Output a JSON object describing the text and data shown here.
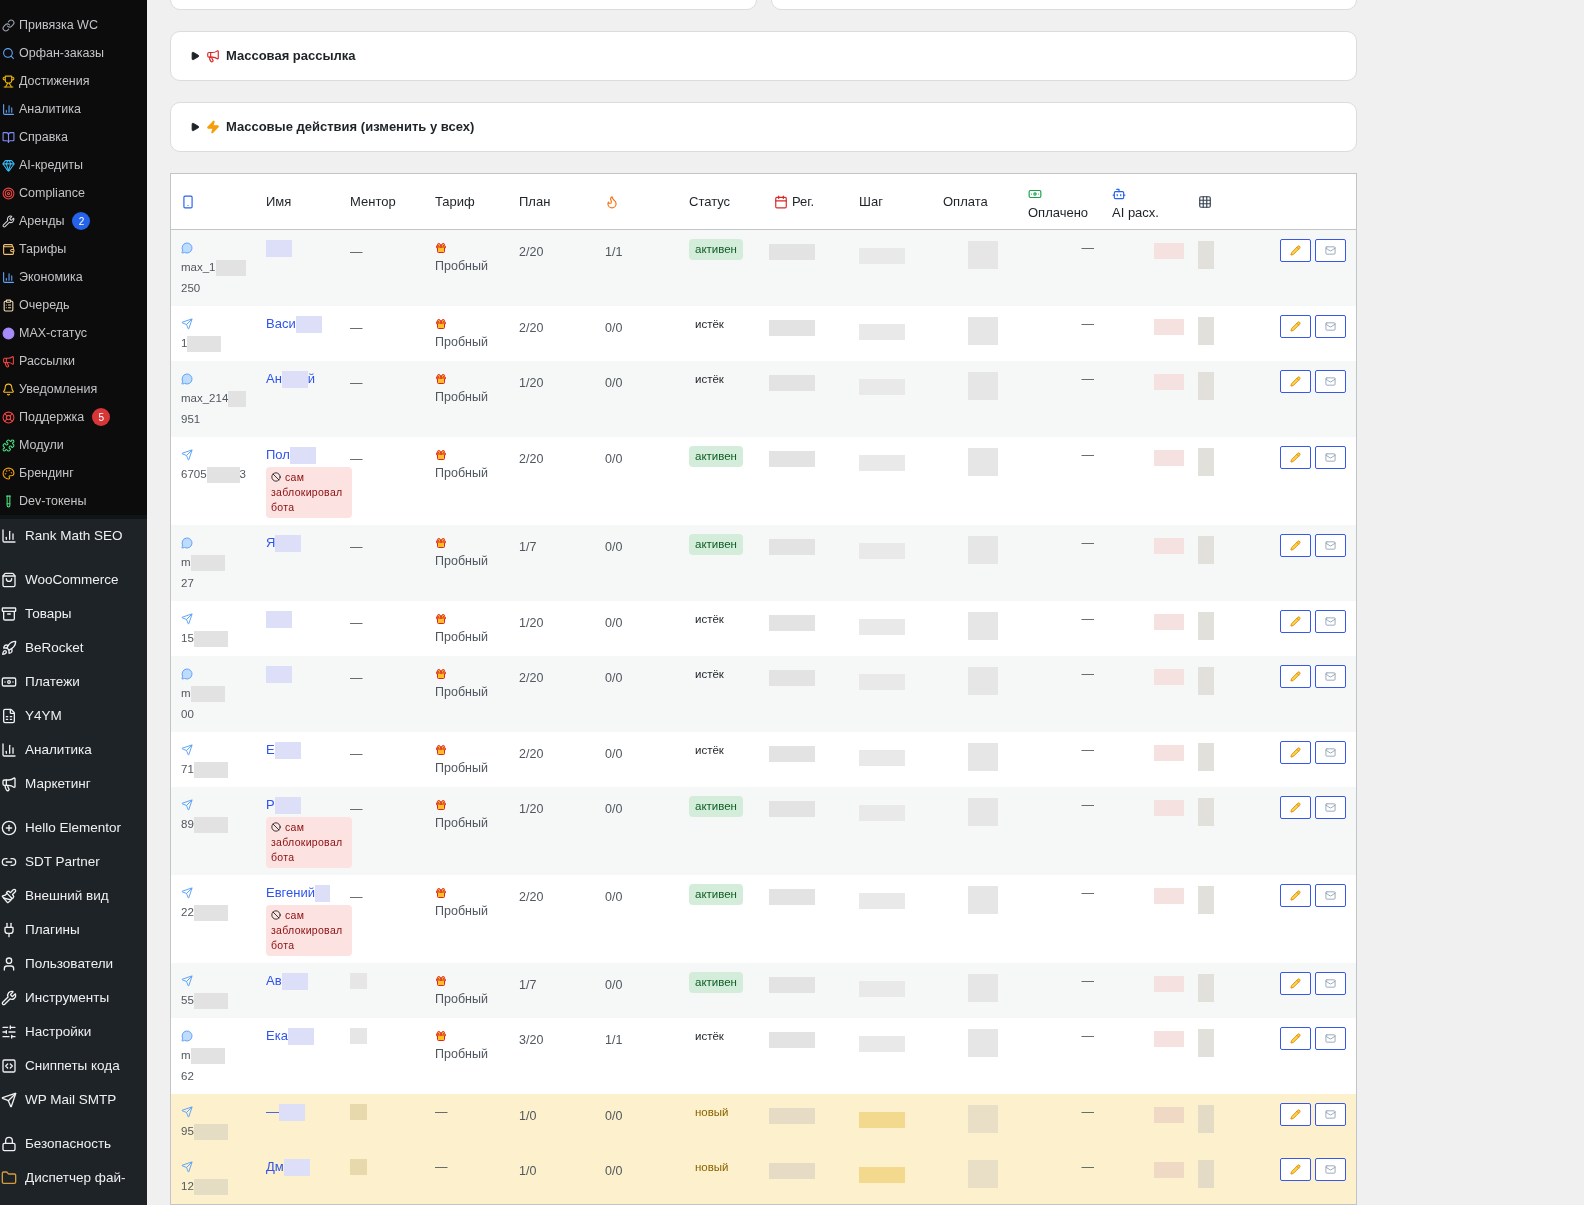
{
  "sidebar": {
    "submenu": [
      {
        "label": "Привязка WC"
      },
      {
        "label": "Орфан-заказы"
      },
      {
        "label": "Достижения"
      },
      {
        "label": "Аналитика"
      },
      {
        "label": "Справка"
      },
      {
        "label": "AI-кредиты"
      },
      {
        "label": "Compliance"
      },
      {
        "label": "Аренды",
        "badge": {
          "count": "2",
          "color": "#2563eb"
        }
      },
      {
        "label": "Тарифы"
      },
      {
        "label": "Экономика"
      },
      {
        "label": "Очередь"
      },
      {
        "label": "MAX-статус"
      },
      {
        "label": "Рассылки"
      },
      {
        "label": "Уведомления"
      },
      {
        "label": "Поддержка",
        "badge": {
          "count": "5",
          "color": "#d63638"
        }
      },
      {
        "label": "Модули"
      },
      {
        "label": "Брендинг"
      },
      {
        "label": "Dev-токены"
      }
    ],
    "menu_groups": [
      [
        "Rank Math SEO"
      ],
      [
        "WooCommerce",
        "Товары",
        "BeRocket",
        "Платежи",
        "Y4YM",
        "Аналитика",
        "Маркетинг"
      ],
      [
        "Hello Elementor",
        "SDT Partner",
        "Внешний вид",
        "Плагины",
        "Пользователи",
        "Инструменты",
        "Настройки",
        "Сниппеты кода",
        "WP Mail SMTP"
      ],
      [
        "Безопасность",
        "Диспетчер фай-"
      ]
    ]
  },
  "panels": [
    {
      "title": "Массовая рассылка",
      "expanded": false
    },
    {
      "title": "Массовые действия (изменить у всех)",
      "expanded": false
    }
  ],
  "table": {
    "columns": [
      {
        "kind": "icon"
      },
      {
        "kind": "text",
        "label": "Имя"
      },
      {
        "kind": "text",
        "label": "Ментор"
      },
      {
        "kind": "text",
        "label": "Тариф"
      },
      {
        "kind": "text",
        "label": "План"
      },
      {
        "kind": "icon"
      },
      {
        "kind": "text",
        "label": "Статус"
      },
      {
        "kind": "icon_inline",
        "label": "Рег."
      },
      {
        "kind": "text",
        "label": "Шаг"
      },
      {
        "kind": "text",
        "label": "Оплата"
      },
      {
        "kind": "icon_stacked",
        "label": "Оплачено"
      },
      {
        "kind": "icon_stacked",
        "label": "AI расх."
      },
      {
        "kind": "icon"
      }
    ],
    "rows": [
      {
        "channel": {
          "kind": "max",
          "id_lines": [
            "max_1",
            "250"
          ]
        },
        "mentor": "—",
        "tariff": {
          "kind": "trial",
          "label": "Пробный"
        },
        "plan": "2/20",
        "streak": "1/1",
        "status": {
          "kind": "active",
          "label": "активен"
        },
        "paid": "—"
      },
      {
        "channel": {
          "kind": "telegram",
          "id_lines": [
            "1"
          ]
        },
        "name": "Васи",
        "mentor": "—",
        "tariff": {
          "kind": "trial",
          "label": "Пробный"
        },
        "plan": "2/20",
        "streak": "0/0",
        "status": {
          "kind": "expired",
          "label": "истёк"
        },
        "paid": "—"
      },
      {
        "channel": {
          "kind": "max",
          "id_lines": [
            "max_214",
            "951"
          ]
        },
        "name": "Ан",
        "name_end": "й",
        "mentor": "—",
        "tariff": {
          "kind": "trial",
          "label": "Пробный"
        },
        "plan": "1/20",
        "streak": "0/0",
        "status": {
          "kind": "expired",
          "label": "истёк"
        },
        "paid": "—"
      },
      {
        "channel": {
          "kind": "telegram",
          "id_lines": [
            "6705"
          ],
          "id_end": "3"
        },
        "name": "Пол",
        "blocked": "сам заблокировал бота",
        "mentor": "—",
        "tariff": {
          "kind": "trial",
          "label": "Пробный"
        },
        "plan": "2/20",
        "streak": "0/0",
        "status": {
          "kind": "active",
          "label": "активен"
        },
        "paid": "—"
      },
      {
        "channel": {
          "kind": "max",
          "id_lines": [
            "m",
            "27"
          ]
        },
        "name": "Я",
        "mentor": "—",
        "tariff": {
          "kind": "trial",
          "label": "Пробный"
        },
        "plan": "1/7",
        "streak": "0/0",
        "status": {
          "kind": "active",
          "label": "активен"
        },
        "paid": "—"
      },
      {
        "channel": {
          "kind": "telegram",
          "id_lines": [
            "15"
          ]
        },
        "mentor": "—",
        "tariff": {
          "kind": "trial",
          "label": "Пробный"
        },
        "plan": "1/20",
        "streak": "0/0",
        "status": {
          "kind": "expired",
          "label": "истёк"
        },
        "paid": "—"
      },
      {
        "channel": {
          "kind": "max",
          "id_lines": [
            "m",
            "00"
          ]
        },
        "mentor": "—",
        "tariff": {
          "kind": "trial",
          "label": "Пробный"
        },
        "plan": "2/20",
        "streak": "0/0",
        "status": {
          "kind": "expired",
          "label": "истёк"
        },
        "paid": "—"
      },
      {
        "channel": {
          "kind": "telegram",
          "id_lines": [
            "71"
          ]
        },
        "name": "Е",
        "mentor": "—",
        "tariff": {
          "kind": "trial",
          "label": "Пробный"
        },
        "plan": "2/20",
        "streak": "0/0",
        "status": {
          "kind": "expired",
          "label": "истёк"
        },
        "paid": "—"
      },
      {
        "channel": {
          "kind": "telegram",
          "id_lines": [
            "89"
          ]
        },
        "name": "Р",
        "blocked": "сам заблокировал бота",
        "mentor": "—",
        "tariff": {
          "kind": "trial",
          "label": "Пробный"
        },
        "plan": "1/20",
        "streak": "0/0",
        "status": {
          "kind": "active",
          "label": "активен"
        },
        "paid": "—"
      },
      {
        "channel": {
          "kind": "telegram",
          "id_lines": [
            "22"
          ]
        },
        "name": "Евгений",
        "blocked": "сам заблокировал бота",
        "mentor": "—",
        "tariff": {
          "kind": "trial",
          "label": "Пробный"
        },
        "plan": "2/20",
        "streak": "0/0",
        "status": {
          "kind": "active",
          "label": "активен"
        },
        "paid": "—"
      },
      {
        "channel": {
          "kind": "telegram",
          "id_lines": [
            "55"
          ]
        },
        "name": "Ав",
        "tariff": {
          "kind": "trial",
          "label": "Пробный"
        },
        "plan": "1/7",
        "streak": "0/0",
        "status": {
          "kind": "active",
          "label": "активен"
        },
        "paid": "—"
      },
      {
        "channel": {
          "kind": "max",
          "id_lines": [
            "m",
            "62"
          ]
        },
        "name": "Ека",
        "tariff": {
          "kind": "trial",
          "label": "Пробный"
        },
        "plan": "3/20",
        "streak": "1/1",
        "status": {
          "kind": "expired",
          "label": "истёк"
        },
        "paid": "—"
      },
      {
        "channel": {
          "kind": "telegram",
          "id_lines": [
            "95"
          ]
        },
        "name": "—",
        "tariff": {
          "kind": "none",
          "label": "—"
        },
        "plan": "1/0",
        "streak": "0/0",
        "status": {
          "kind": "new",
          "label": "новый"
        },
        "paid": "—"
      },
      {
        "channel": {
          "kind": "telegram",
          "id_lines": [
            "12"
          ]
        },
        "name": "Дм",
        "tariff": {
          "kind": "none",
          "label": "—"
        },
        "plan": "1/0",
        "streak": "0/0",
        "status": {
          "kind": "new",
          "label": "новый"
        },
        "paid": "—"
      }
    ]
  }
}
